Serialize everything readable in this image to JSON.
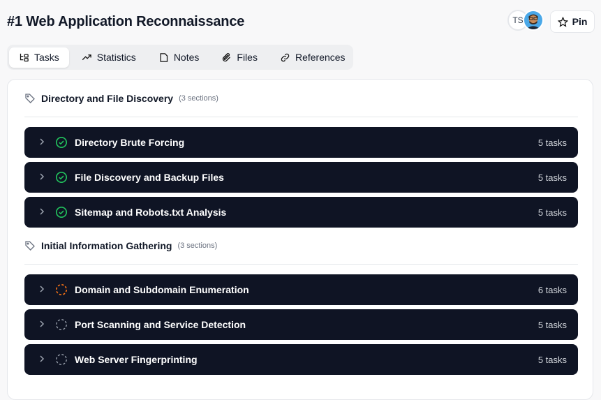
{
  "header": {
    "title": "#1 Web Application Reconnaissance",
    "avatar_initials": "TS",
    "pin_label": "Pin"
  },
  "tabs": [
    {
      "label": "Tasks",
      "icon": "tasks-tree-icon",
      "active": true
    },
    {
      "label": "Statistics",
      "icon": "trending-up-icon"
    },
    {
      "label": "Notes",
      "icon": "note-icon"
    },
    {
      "label": "Files",
      "icon": "paperclip-icon"
    },
    {
      "label": "References",
      "icon": "link-icon"
    }
  ],
  "colors": {
    "row_bg": "#0f1424",
    "complete": "#22c55e",
    "in_progress": "#f97316",
    "pending": "#9ca3af"
  },
  "groups": [
    {
      "name": "Directory and File Discovery",
      "count": "(3 sections)",
      "items": [
        {
          "name": "Directory Brute Forcing",
          "count": "5 tasks",
          "status": "complete"
        },
        {
          "name": "File Discovery and Backup Files",
          "count": "5 tasks",
          "status": "complete"
        },
        {
          "name": "Sitemap and Robots.txt Analysis",
          "count": "5 tasks",
          "status": "complete"
        }
      ]
    },
    {
      "name": "Initial Information Gathering",
      "count": "(3 sections)",
      "items": [
        {
          "name": "Domain and Subdomain Enumeration",
          "count": "6 tasks",
          "status": "in_progress"
        },
        {
          "name": "Port Scanning and Service Detection",
          "count": "5 tasks",
          "status": "pending"
        },
        {
          "name": "Web Server Fingerprinting",
          "count": "5 tasks",
          "status": "pending"
        }
      ]
    }
  ]
}
